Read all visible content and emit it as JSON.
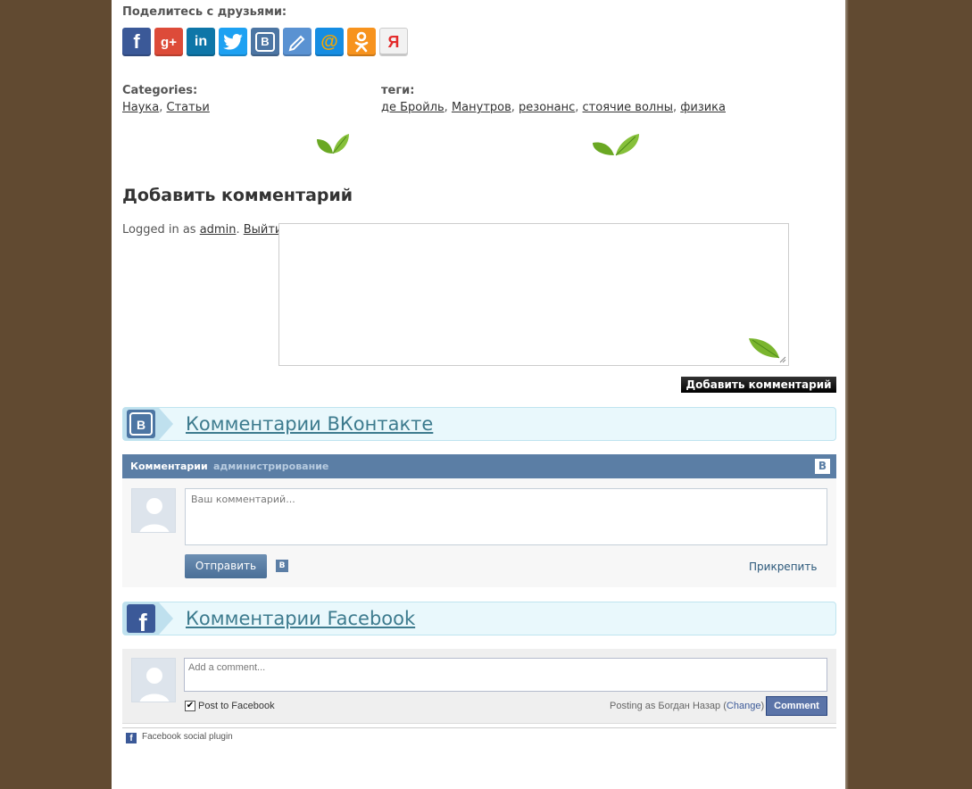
{
  "share": {
    "title": "Поделитесь с друзьями:",
    "buttons": [
      {
        "name": "facebook",
        "glyph": "f"
      },
      {
        "name": "google-plus",
        "glyph": "g+"
      },
      {
        "name": "linkedin",
        "glyph": "in"
      },
      {
        "name": "twitter",
        "glyph": ""
      },
      {
        "name": "vkontakte",
        "glyph": "B"
      },
      {
        "name": "livejournal",
        "glyph": ""
      },
      {
        "name": "mail-ru",
        "glyph": "@"
      },
      {
        "name": "odnoklassniki",
        "glyph": ""
      },
      {
        "name": "yandex",
        "glyph": "Я"
      }
    ]
  },
  "categories": {
    "label": "Categories:",
    "items": [
      "Наука",
      "Статьи"
    ]
  },
  "tags": {
    "label": "теги:",
    "items": [
      "де Бройль",
      "Манутров",
      "резонанс",
      "стоячие волны",
      "физика"
    ]
  },
  "comment_form": {
    "heading": "Добавить комментарий",
    "logged_in_prefix": "Logged in as",
    "user": "admin",
    "logout": "Выйти",
    "submit": "Добавить комментарий"
  },
  "vk_section": {
    "title": "Комментарии ВКонтакте",
    "widget": {
      "tab_comments": "Комментарии",
      "tab_admin": "администрирование",
      "placeholder": "Ваш комментарий...",
      "send": "Отправить",
      "attach": "Прикрепить",
      "logo": "B"
    }
  },
  "fb_section": {
    "title": "Комментарии Facebook",
    "widget": {
      "placeholder": "Add a comment...",
      "post_to_facebook": "Post to Facebook",
      "posting_as": "Posting as Богдан Назар",
      "change": "Change",
      "comment_button": "Comment",
      "plugin_label": "Facebook social plugin"
    }
  },
  "colors": {
    "page_background": "#614a31",
    "vk_blue": "#5b7ea5",
    "fb_blue": "#3b5998",
    "section_title": "#3d7b8e"
  }
}
